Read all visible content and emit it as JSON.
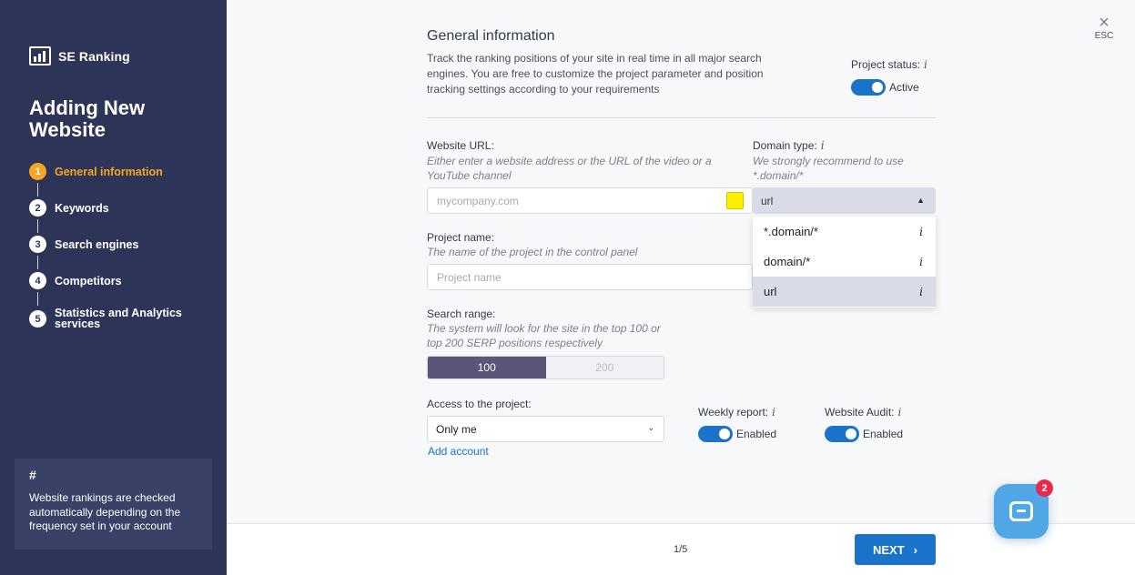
{
  "sidebar": {
    "brand": "SE Ranking",
    "title": "Adding New Website",
    "steps": [
      {
        "num": "1",
        "label": "General information"
      },
      {
        "num": "2",
        "label": "Keywords"
      },
      {
        "num": "3",
        "label": "Search engines"
      },
      {
        "num": "4",
        "label": "Competitors"
      },
      {
        "num": "5",
        "label": "Statistics and Analytics services"
      }
    ],
    "tip": {
      "hash": "#",
      "text": "Website rankings are checked automatically depending on the frequency set in your account"
    }
  },
  "close": {
    "icon": "×",
    "label": "ESC"
  },
  "general": {
    "title": "General information",
    "description": "Track the ranking positions of your site in real time in all major search engines. You are free to customize the project parameter and position tracking settings according to your requirements",
    "status_label": "Project status:",
    "status_value": "Active",
    "info_glyph": "i"
  },
  "website_url": {
    "label": "Website URL:",
    "hint": "Either enter a website address or the URL of the video or a YouTube channel",
    "placeholder": "mycompany.com",
    "color_marker": "#ffee00"
  },
  "domain_type": {
    "label": "Domain type:",
    "hint": "We strongly recommend to use *.domain/*",
    "value": "url",
    "options": [
      "*.domain/*",
      "domain/*",
      "url"
    ]
  },
  "project_name": {
    "label": "Project name:",
    "hint": "The name of the project in the control panel",
    "placeholder": "Project name"
  },
  "search_range": {
    "label": "Search range:",
    "hint": "The system will look for the site in the top 100 or top 200 SERP positions respectively",
    "options": [
      "100",
      "200"
    ],
    "selected": "100"
  },
  "access": {
    "label": "Access to the project:",
    "value": "Only me",
    "add_link": "Add account"
  },
  "weekly_report": {
    "label": "Weekly report:",
    "value": "Enabled"
  },
  "website_audit": {
    "label": "Website Audit:",
    "value": "Enabled"
  },
  "footer": {
    "pager": "1/5",
    "next_label": "NEXT"
  },
  "chat": {
    "badge": "2"
  },
  "colors": {
    "sidebar": "#2d3457",
    "accent": "#1a73c9",
    "active_step": "#f5a623",
    "badge": "#e8294e"
  }
}
